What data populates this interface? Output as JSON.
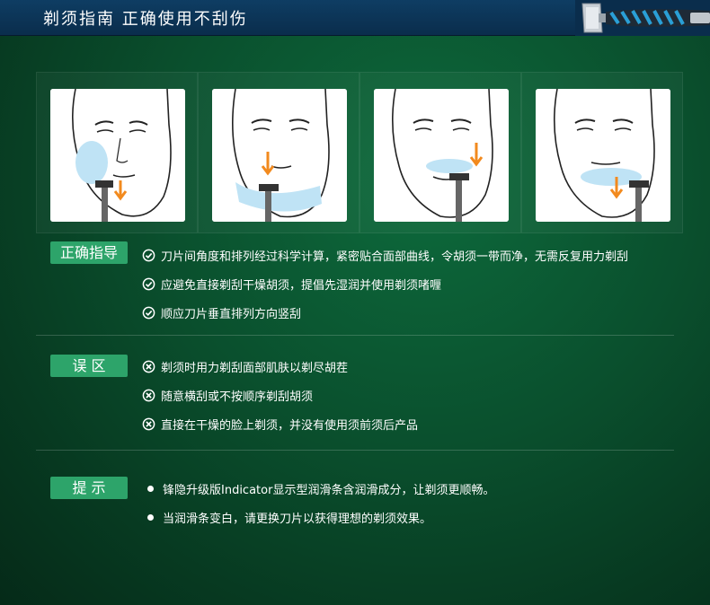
{
  "header": {
    "title": "剃须指南  正确使用不刮伤"
  },
  "faces": [
    {
      "label": "face-1"
    },
    {
      "label": "face-2"
    },
    {
      "label": "face-3"
    },
    {
      "label": "face-4"
    }
  ],
  "sections": {
    "correct": {
      "label": "正确指导",
      "items": [
        "刀片间角度和排列经过科学计算，紧密贴合面部曲线，令胡须一带而净，无需反复用力剃刮",
        "应避免直接剃刮干燥胡须，提倡先湿润并使用剃须啫喱",
        "顺应刀片垂直排列方向竖刮"
      ]
    },
    "mistakes": {
      "label": "误    区",
      "items": [
        "剃须时用力剃刮面部肌肤以剃尽胡茬",
        "随意横刮或不按顺序剃刮胡须",
        "直接在干燥的脸上剃须，并没有使用须前须后产品"
      ]
    },
    "tips": {
      "label": "提    示",
      "items": [
        "锋隐升级版Indicator显示型润滑条含润滑成分，让剃须更顺畅。",
        "当润滑条变白，请更换刀片以获得理想的剃须效果。"
      ]
    }
  },
  "colors": {
    "accent": "#2da46a",
    "header_bg": "#0e3d63",
    "arrow": "#f28a1e",
    "foam": "#bfe3f5"
  }
}
